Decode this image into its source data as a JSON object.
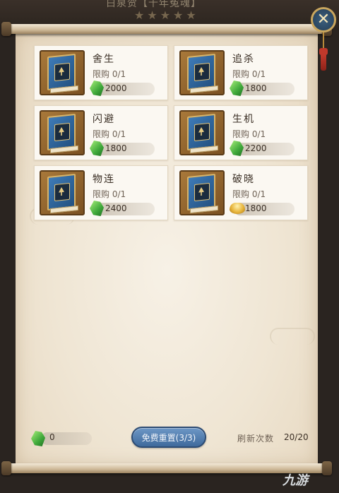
{
  "backdrop": {
    "title": "白泉贺【千年冤魂】",
    "stars": "★★★★★"
  },
  "close_icon": "close-x-icon",
  "items": [
    {
      "name": "舍生",
      "limit": "限购 0/1",
      "price": "2000",
      "currency": "jade-gem-icon"
    },
    {
      "name": "追杀",
      "limit": "限购 0/1",
      "price": "1800",
      "currency": "jade-gem-icon"
    },
    {
      "name": "闪避",
      "limit": "限购 0/1",
      "price": "1800",
      "currency": "jade-gem-icon"
    },
    {
      "name": "生机",
      "limit": "限购 0/1",
      "price": "2200",
      "currency": "jade-gem-icon"
    },
    {
      "name": "物连",
      "limit": "限购 0/1",
      "price": "2400",
      "currency": "jade-gem-icon"
    },
    {
      "name": "破晓",
      "limit": "限购 0/1",
      "price": "1800",
      "currency": "gold-ingot-icon"
    }
  ],
  "footer": {
    "currency_amount": "0",
    "reset_button": "免费重置(3/3)",
    "refresh_label": "刷新次数",
    "refresh_count": "20/20"
  },
  "watermark": "九游",
  "colors": {
    "panel": "#efe5d3",
    "button": "#4f7bb0",
    "jade": "#3fa83a",
    "gold": "#e7b43a",
    "accent_gold": "#c9a65e"
  }
}
